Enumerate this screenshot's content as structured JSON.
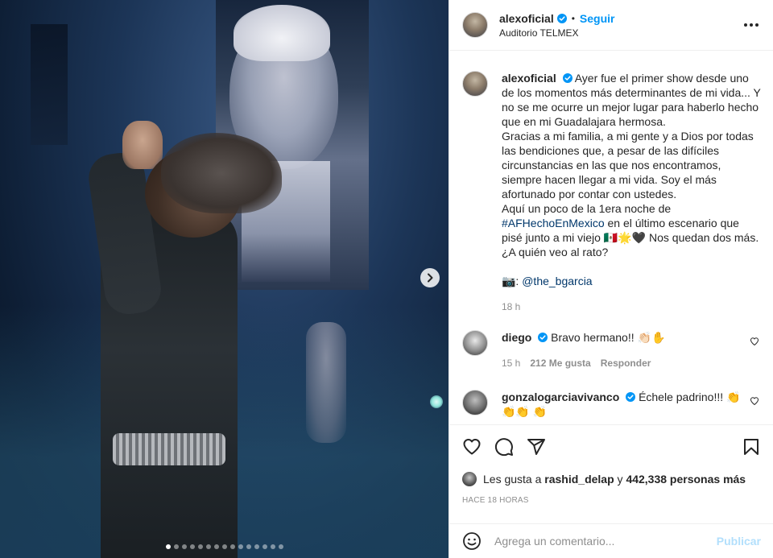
{
  "post": {
    "username": "alexoficial",
    "follow_label": "Seguir",
    "dot": "•",
    "location": "Auditorio TELMEX"
  },
  "caption": {
    "username": "alexoficial",
    "line1": "Ayer fue el primer show desde uno de los momentos más determinantes de mi vida... Y no se me ocurre un mejor lugar para haberlo hecho que en mi Guadalajara hermosa.",
    "line2": "Gracias a mi familia, a mi gente y a Dios por todas las bendiciones que, a pesar de las difíciles circunstancias en las que nos encontramos, siempre hacen llegar a mi vida. Soy el más afortunado por contar con ustedes.",
    "line3_prefix": "Aquí un poco de la 1era noche de",
    "hashtag": "#AFHechoEnMexico",
    "line3_suffix": "en el último escenario que pisé junto a mi viejo 🇲🇽🌟🖤 Nos quedan dos más.",
    "line4": "¿A quién veo al rato?",
    "credit_icon": "📷:",
    "credit_mention": "@the_bgarcia",
    "time": "18 h"
  },
  "comments": [
    {
      "username": "diego",
      "text": "Bravo hermano!! 👏🏻✋",
      "time": "15 h",
      "likes": "212 Me gusta",
      "reply": "Responder"
    },
    {
      "username": "gonzalogarciavivanco",
      "text": "Échele padrino!!! 👏👏👏 👏"
    }
  ],
  "likes": {
    "prefix": "Les gusta a",
    "user": "rashid_delap",
    "and": "y",
    "others": "442,338 personas más"
  },
  "timestamp": "HACE 18 HORAS",
  "add_comment": {
    "placeholder": "Agrega un comentario...",
    "post_label": "Publicar"
  },
  "carousel": {
    "total": 15,
    "active_index": 0
  },
  "colors": {
    "accent": "#0095f6",
    "link": "#00376b",
    "muted": "#8e8e8e",
    "border": "#efefef",
    "post_disabled": "#b2dffc"
  }
}
